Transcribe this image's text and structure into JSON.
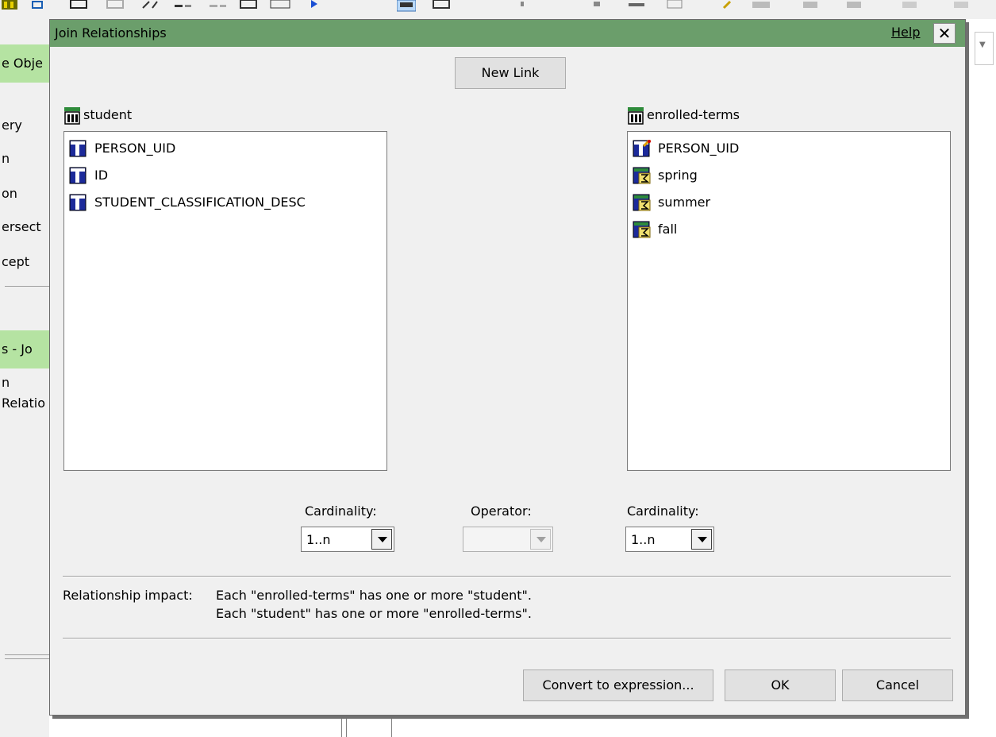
{
  "dialog": {
    "title": "Join Relationships",
    "help_label": "Help",
    "close_label": "✕",
    "new_link_label": "New Link",
    "left_table": {
      "name": "student",
      "columns": [
        "PERSON_UID",
        "ID",
        "STUDENT_CLASSIFICATION_DESC"
      ]
    },
    "right_table": {
      "name": "enrolled-terms",
      "columns": [
        "PERSON_UID",
        "spring",
        "summer",
        "fall"
      ]
    },
    "left_cardinality": {
      "label": "Cardinality:",
      "value": "1..n"
    },
    "operator": {
      "label": "Operator:",
      "value": ""
    },
    "right_cardinality": {
      "label": "Cardinality:",
      "value": "1..n"
    },
    "impact": {
      "label": "Relationship impact:",
      "line1": "Each \"enrolled-terms\" has one or more \"student\".",
      "line2": "Each \"student\" has one or more \"enrolled-terms\"."
    },
    "convert_label": "Convert to expression...",
    "ok_label": "OK",
    "cancel_label": "Cancel"
  },
  "background": {
    "left_pane": {
      "header1": "e Obje",
      "items": [
        "ery",
        "n",
        "on",
        "ersect",
        "cept"
      ],
      "header2": "s - Jo",
      "item2": "n",
      "item3": "Relatio"
    }
  },
  "colors": {
    "titlebar": "#6b9e6b",
    "pane_header": "#b5e3a2",
    "dialog_bg": "#f0f0f0"
  },
  "icons": {
    "table": "table-icon",
    "column": "column-icon",
    "key_column": "key-column-icon",
    "measure_column": "measure-column-icon"
  }
}
